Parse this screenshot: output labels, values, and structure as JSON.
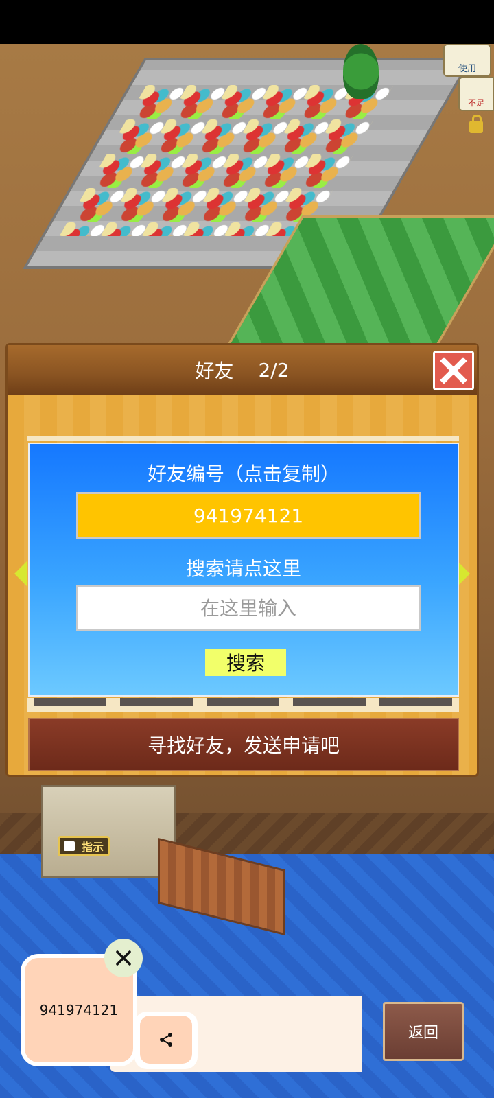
{
  "game": {
    "hud": {
      "use_label": "使用",
      "shortage_label": "不足",
      "guide_label": "指示"
    }
  },
  "dialog": {
    "title": "好友",
    "count": "2/2",
    "friend_id_title": "好友编号（点击复制）",
    "friend_id": "941974121",
    "search_label": "搜索请点这里",
    "search_placeholder": "在这里输入",
    "search_button": "搜索",
    "find_button": "寻找好友，发送申请吧"
  },
  "share_overlay": {
    "copied_text": "941974121"
  },
  "back_button": "返回",
  "colors": {
    "dialog_header": "#8a5422",
    "panel_blue": "#1578ff",
    "id_box": "#ffc400",
    "search_button": "#f2ff6a",
    "close_button": "#e25b4e",
    "copy_card": "#ffd4b8"
  }
}
